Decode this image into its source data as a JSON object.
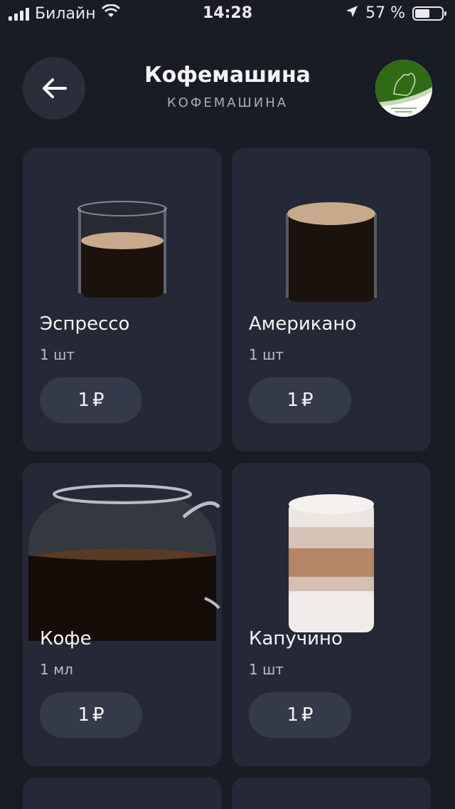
{
  "status_bar": {
    "carrier": "Билайн",
    "time": "14:28",
    "battery_percent": "57 %"
  },
  "header": {
    "title": "Кофемашина",
    "subtitle": "КОФЕМАШИНА"
  },
  "products": [
    {
      "name": "Эспрессо",
      "quantity": "1 шт",
      "price": "1",
      "currency": "₽"
    },
    {
      "name": "Американо",
      "quantity": "1 шт",
      "price": "1",
      "currency": "₽"
    },
    {
      "name": "Кофе",
      "quantity": "1 мл",
      "price": "1",
      "currency": "₽"
    },
    {
      "name": "Капучино",
      "quantity": "1 шт",
      "price": "1",
      "currency": "₽"
    }
  ],
  "colors": {
    "background": "#191c25",
    "card": "#252937",
    "button": "#353a4a",
    "logo_green": "#2e6b14"
  }
}
